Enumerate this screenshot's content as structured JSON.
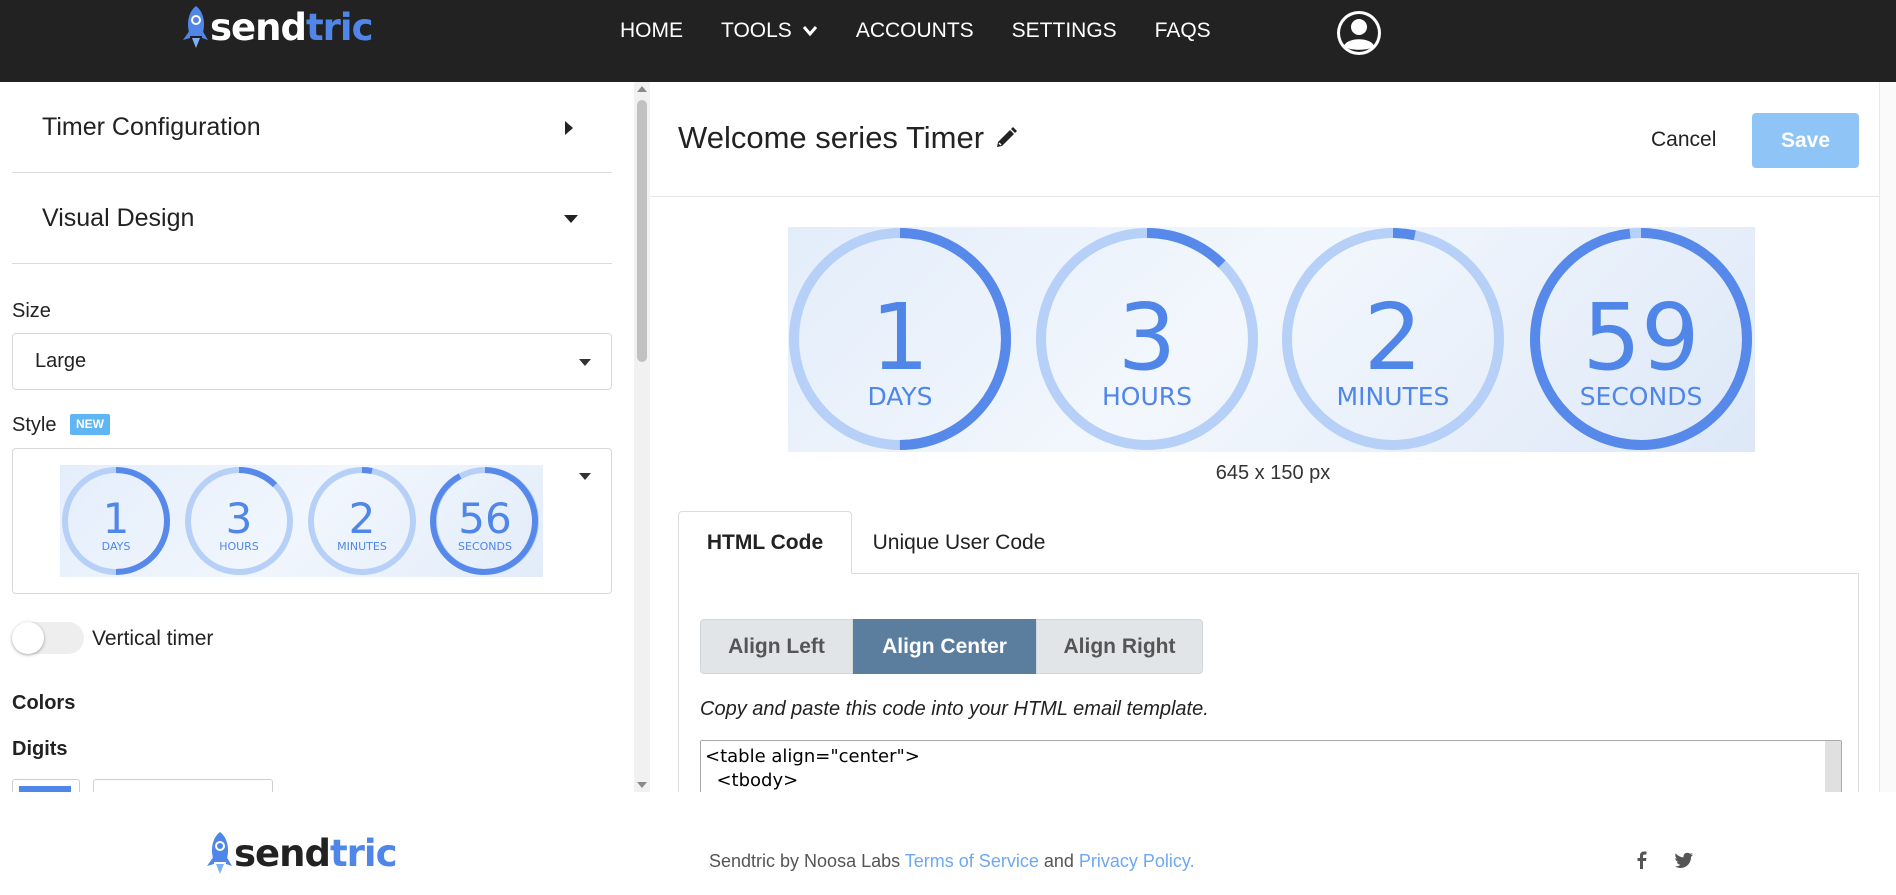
{
  "brand": {
    "name_part1": "send",
    "name_part2": "tric"
  },
  "nav": {
    "items": [
      {
        "label": "HOME"
      },
      {
        "label": "TOOLS"
      },
      {
        "label": "ACCOUNTS"
      },
      {
        "label": "SETTINGS"
      },
      {
        "label": "FAQS"
      }
    ]
  },
  "sidebar": {
    "sections": [
      {
        "title": "Timer Configuration",
        "state": "collapsed"
      },
      {
        "title": "Visual Design",
        "state": "expanded"
      }
    ],
    "size": {
      "label": "Size",
      "value": "Large"
    },
    "style": {
      "label": "Style",
      "badge": "NEW",
      "preview": [
        {
          "number": "1",
          "unit": "DAYS"
        },
        {
          "number": "3",
          "unit": "HOURS"
        },
        {
          "number": "2",
          "unit": "MINUTES"
        },
        {
          "number": "56",
          "unit": "SECONDS"
        }
      ]
    },
    "vertical_timer": {
      "label": "Vertical timer",
      "enabled": false
    },
    "colors": {
      "heading": "Colors",
      "digits_label": "Digits",
      "digits_color": "#4f86e8"
    }
  },
  "editor": {
    "title": "Welcome series Timer",
    "cancel_label": "Cancel",
    "save_label": "Save",
    "timer": [
      {
        "number": "1",
        "unit": "DAYS",
        "progress": 0.5
      },
      {
        "number": "3",
        "unit": "HOURS",
        "progress": 0.125
      },
      {
        "number": "2",
        "unit": "MINUTES",
        "progress": 0.033
      },
      {
        "number": "59",
        "unit": "SECONDS",
        "progress": 0.983
      }
    ],
    "dimensions": "645 x 150 px",
    "tabs": [
      {
        "label": "HTML Code",
        "active": true
      },
      {
        "label": "Unique User Code",
        "active": false
      }
    ],
    "align_buttons": [
      {
        "label": "Align Left",
        "active": false
      },
      {
        "label": "Align Center",
        "active": true
      },
      {
        "label": "Align Right",
        "active": false
      }
    ],
    "copy_hint": "Copy and paste this code into your HTML email template.",
    "code": "<table align=\"center\">\n  <tbody>"
  },
  "footer": {
    "prefix": "Sendtric by Noosa Labs ",
    "terms_label": "Terms of Service",
    "and_text": " and ",
    "privacy_label": "Privacy Policy",
    "suffix": ".",
    "social": [
      "facebook-icon",
      "twitter-icon"
    ]
  },
  "colors": {
    "navbar": "#222222",
    "accent": "#4f86e8",
    "ring_light": "#b7d0f7",
    "save_button": "#8ec4f6",
    "align_active": "#5b7e9e",
    "link": "#6ea8f0"
  }
}
